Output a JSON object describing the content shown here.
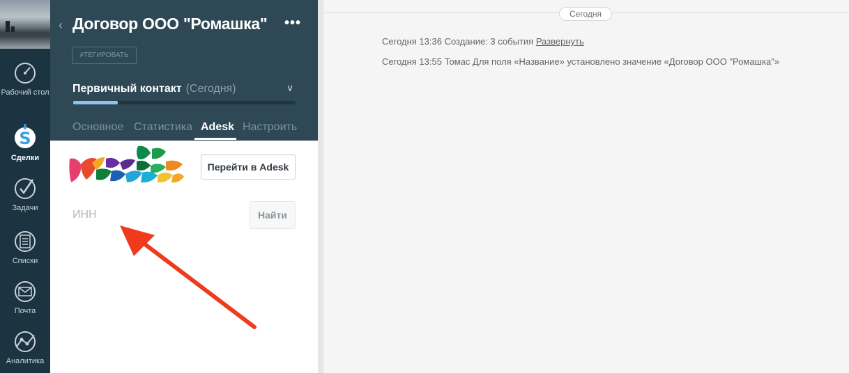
{
  "nav": {
    "items": [
      {
        "label": "Рабочий стол",
        "icon": "speedometer-icon"
      },
      {
        "label": "Сделки",
        "icon": "dollar-icon",
        "active": true
      },
      {
        "label": "Задачи",
        "icon": "checkmark-icon"
      },
      {
        "label": "Списки",
        "icon": "list-icon"
      },
      {
        "label": "Почта",
        "icon": "mail-icon"
      },
      {
        "label": "Аналитика",
        "icon": "analytics-icon"
      }
    ]
  },
  "card": {
    "title": "Договор ООО \"Ромашка\"",
    "more": "•••",
    "tag_button": "#ТЕГИРОВАТЬ",
    "stage": {
      "name": "Первичный контакт",
      "date": "(Сегодня)",
      "progress_percent": 20
    },
    "tabs": [
      {
        "label": "Основное"
      },
      {
        "label": "Статистика"
      },
      {
        "label": "Adesk",
        "active": true
      },
      {
        "label": "Настроить"
      }
    ],
    "adesk": {
      "goto_button": "Перейти в Adesk",
      "inn_placeholder": "ИНН",
      "find_button": "Найти"
    }
  },
  "feed": {
    "date_label": "Сегодня",
    "events": [
      {
        "text": "Сегодня 13:36 Создание: 3 события ",
        "link": "Развернуть"
      },
      {
        "text": "Сегодня 13:55 Томас Для поля «Название» установлено значение «Договор ООО \"Ромашка\"»",
        "link": ""
      }
    ]
  },
  "colors": {
    "nav_bg": "#1c3441",
    "card_head_bg": "#2e4855",
    "progress_fill": "#8ec3ea",
    "annotation_arrow": "#f03a1e"
  }
}
